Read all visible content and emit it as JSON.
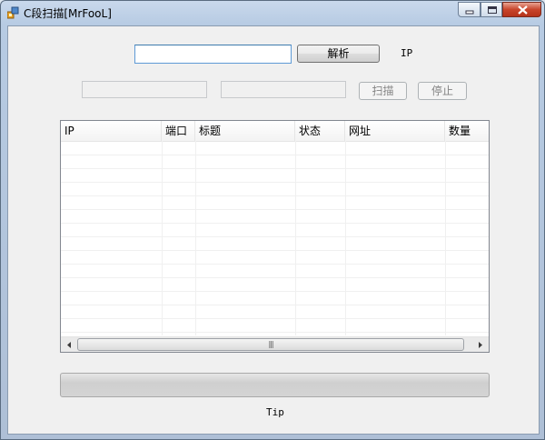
{
  "window": {
    "title": "C段扫描[MrFooL]",
    "controls": [
      "minimize",
      "maximize",
      "close"
    ]
  },
  "form": {
    "ip_input_value": "",
    "parse_button": "解析",
    "ip_label": "IP",
    "range_start_value": "",
    "range_end_value": "",
    "scan_button": "扫描",
    "stop_button": "停止"
  },
  "table": {
    "columns": [
      "IP",
      "端口",
      "标题",
      "状态",
      "网址",
      "数量"
    ],
    "rows": []
  },
  "progress": {
    "value": 0
  },
  "status": {
    "tip": "Tip"
  },
  "colors": {
    "accent": "#5e9ad6",
    "close": "#c8442b",
    "progress_fill": "#06b025"
  }
}
